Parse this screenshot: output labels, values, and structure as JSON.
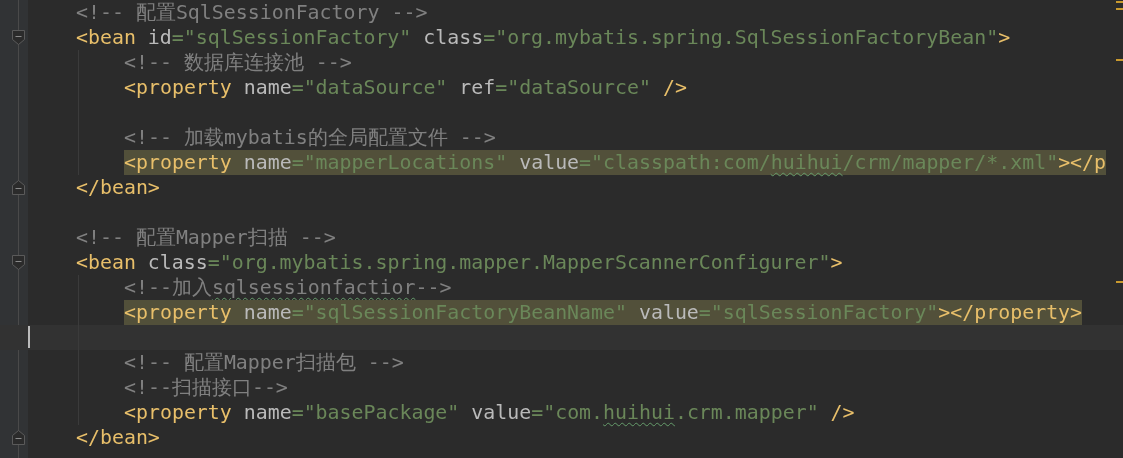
{
  "editor": {
    "lines": [
      {
        "highlighted": false,
        "current": false,
        "tokens": [
          {
            "kind": "comment",
            "text": "<!-- 配置SqlSessionFactory -->",
            "misspelled": false
          }
        ]
      },
      {
        "highlighted": false,
        "current": false,
        "kind": "open",
        "tokens": [
          {
            "kind": "tag",
            "text": "<bean ",
            "misspelled": false
          },
          {
            "kind": "attr",
            "text": "id",
            "misspelled": false
          },
          {
            "kind": "value",
            "text": "=\"sqlSessionFactory\" ",
            "misspelled": false
          },
          {
            "kind": "attr",
            "text": "class",
            "misspelled": false
          },
          {
            "kind": "value",
            "text": "=\"org.mybatis.spring.SqlSessionFactoryBean\"",
            "misspelled": false
          },
          {
            "kind": "tag",
            "text": ">",
            "misspelled": false
          }
        ],
        "children": [
          {
            "highlighted": false,
            "current": false,
            "tokens": [
              {
                "kind": "comment",
                "text": "<!-- 数据库连接池 -->",
                "misspelled": false
              }
            ]
          },
          {
            "highlighted": false,
            "current": false,
            "tokens": [
              {
                "kind": "tag",
                "text": "<property ",
                "misspelled": false
              },
              {
                "kind": "attr",
                "text": "name",
                "misspelled": false
              },
              {
                "kind": "value",
                "text": "=\"dataSource\" ",
                "misspelled": false
              },
              {
                "kind": "attr",
                "text": "ref",
                "misspelled": false
              },
              {
                "kind": "value",
                "text": "=\"dataSource\" ",
                "misspelled": false
              },
              {
                "kind": "tag",
                "text": "/>",
                "misspelled": false
              }
            ]
          },
          {
            "highlighted": false,
            "current": false
          },
          {
            "highlighted": false,
            "current": false,
            "tokens": [
              {
                "kind": "comment",
                "text": "<!-- 加载mybatis的全局配置文件 -->",
                "misspelled": false
              }
            ]
          },
          {
            "highlighted": true,
            "current": false,
            "tokens": [
              {
                "kind": "tag",
                "text": "<property ",
                "misspelled": false
              },
              {
                "kind": "attr",
                "text": "name",
                "misspelled": false
              },
              {
                "kind": "value",
                "text": "=\"mapperLocations\" ",
                "misspelled": false
              },
              {
                "kind": "attr",
                "text": "value",
                "misspelled": false
              },
              {
                "kind": "value",
                "text": "=\"classpath:com/",
                "misspelled": false
              },
              {
                "kind": "value",
                "text": "huihui",
                "misspelled": true
              },
              {
                "kind": "value",
                "text": "/crm/mapper/*.xml\"",
                "misspelled": false
              },
              {
                "kind": "tag",
                "text": "></p",
                "misspelled": false
              }
            ]
          }
        ]
      },
      {
        "highlighted": false,
        "current": false,
        "kind": "close",
        "tokens": [
          {
            "kind": "tag",
            "text": "</bean>",
            "misspelled": false
          }
        ]
      },
      {
        "highlighted": false,
        "current": false
      },
      {
        "highlighted": false,
        "current": false,
        "tokens": [
          {
            "kind": "comment",
            "text": "<!-- 配置Mapper扫描 -->",
            "misspelled": false
          }
        ]
      },
      {
        "highlighted": false,
        "current": false,
        "kind": "open",
        "tokens": [
          {
            "kind": "tag",
            "text": "<bean ",
            "misspelled": false
          },
          {
            "kind": "attr",
            "text": "class",
            "misspelled": false
          },
          {
            "kind": "value",
            "text": "=\"org.mybatis.spring.mapper.MapperScannerConfigurer\"",
            "misspelled": false
          },
          {
            "kind": "tag",
            "text": ">",
            "misspelled": false
          }
        ],
        "children": [
          {
            "highlighted": false,
            "current": false,
            "tokens": [
              {
                "kind": "comment",
                "text": "<!--加入",
                "misspelled": false
              },
              {
                "kind": "comment",
                "text": "sqlsessionfactior",
                "misspelled": true
              },
              {
                "kind": "comment",
                "text": "-->",
                "misspelled": false
              }
            ]
          },
          {
            "highlighted": true,
            "current": false,
            "tokens": [
              {
                "kind": "tag",
                "text": "<property ",
                "misspelled": false
              },
              {
                "kind": "attr",
                "text": "name",
                "misspelled": false
              },
              {
                "kind": "value",
                "text": "=\"sqlSessionFactoryBeanName\" ",
                "misspelled": false
              },
              {
                "kind": "attr",
                "text": "value",
                "misspelled": false
              },
              {
                "kind": "value",
                "text": "=\"sqlSessionFactory\"",
                "misspelled": false
              },
              {
                "kind": "tag",
                "text": "></property>",
                "misspelled": false
              }
            ]
          },
          {
            "highlighted": false,
            "current": true
          },
          {
            "highlighted": false,
            "current": false,
            "tokens": [
              {
                "kind": "comment",
                "text": "<!-- 配置Mapper扫描包 -->",
                "misspelled": false
              }
            ]
          },
          {
            "highlighted": false,
            "current": false,
            "tokens": [
              {
                "kind": "comment",
                "text": "<!--扫描接口-->",
                "misspelled": false
              }
            ]
          },
          {
            "highlighted": false,
            "current": false,
            "tokens": [
              {
                "kind": "tag",
                "text": "<property ",
                "misspelled": false
              },
              {
                "kind": "attr",
                "text": "name",
                "misspelled": false
              },
              {
                "kind": "value",
                "text": "=\"basePackage\" ",
                "misspelled": false
              },
              {
                "kind": "attr",
                "text": "value",
                "misspelled": false
              },
              {
                "kind": "value",
                "text": "=\"com.",
                "misspelled": false
              },
              {
                "kind": "value",
                "text": "huihui",
                "misspelled": true
              },
              {
                "kind": "value",
                "text": ".crm.mapper\" ",
                "misspelled": false
              },
              {
                "kind": "tag",
                "text": "/>",
                "misspelled": false
              }
            ]
          }
        ]
      },
      {
        "highlighted": false,
        "current": false,
        "kind": "close",
        "tokens": [
          {
            "kind": "tag",
            "text": "</bean>",
            "misspelled": false
          }
        ]
      }
    ]
  }
}
